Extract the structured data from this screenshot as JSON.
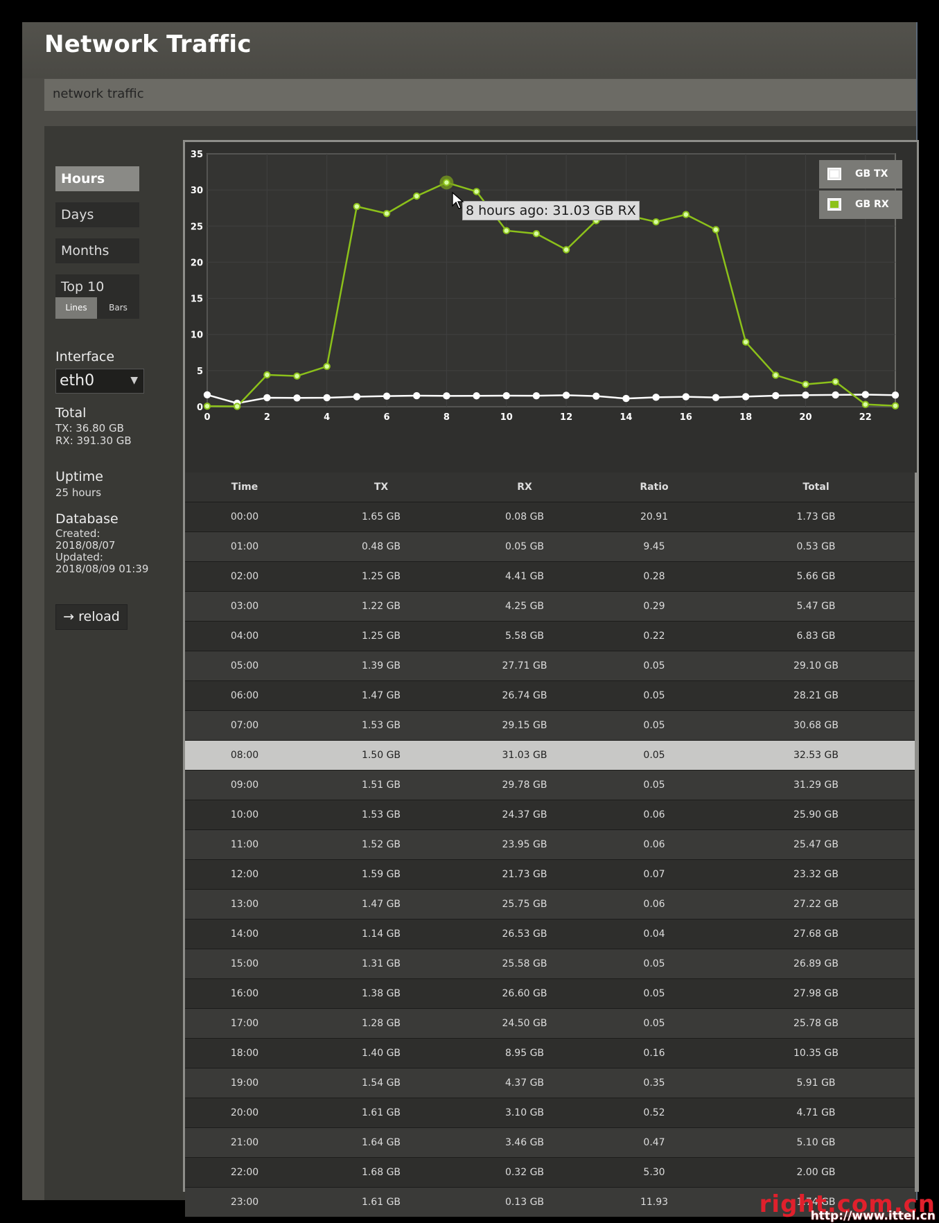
{
  "app": {
    "title": "Network Traffic",
    "subtitle": "network traffic"
  },
  "sidebar": {
    "nav": [
      {
        "label": "Hours",
        "active": true
      },
      {
        "label": "Days",
        "active": false
      },
      {
        "label": "Months",
        "active": false
      },
      {
        "label": "Top 10",
        "active": false
      }
    ],
    "view_toggle": {
      "lines": "Lines",
      "bars": "Bars",
      "selected": "Lines"
    },
    "interface_label": "Interface",
    "interface_value": "eth0",
    "total_label": "Total",
    "total_tx": "TX: 36.80 GB",
    "total_rx": "RX: 391.30 GB",
    "uptime_label": "Uptime",
    "uptime_value": "25 hours",
    "database_label": "Database",
    "created_label": "Created:",
    "created_value": "2018/08/07",
    "updated_label": "Updated:",
    "updated_value": "2018/08/09 01:39",
    "reload_label": "→ reload"
  },
  "legend": {
    "tx": "GB TX",
    "rx": "GB RX"
  },
  "tooltip": "8 hours ago: 31.03 GB RX",
  "colors": {
    "tx": "#ffffff",
    "rx": "#8cc11a",
    "grid": "#404040",
    "watermark": "#e0202c"
  },
  "chart_data": {
    "type": "line",
    "x": [
      0,
      1,
      2,
      3,
      4,
      5,
      6,
      7,
      8,
      9,
      10,
      11,
      12,
      13,
      14,
      15,
      16,
      17,
      18,
      19,
      20,
      21,
      22,
      23
    ],
    "x_ticks": [
      "0",
      "2",
      "4",
      "6",
      "8",
      "10",
      "12",
      "14",
      "16",
      "18",
      "20",
      "22"
    ],
    "y_ticks": [
      "0",
      "5",
      "10",
      "15",
      "20",
      "25",
      "30",
      "35"
    ],
    "ylim": [
      0,
      35
    ],
    "xlim": [
      0,
      23
    ],
    "grid": true,
    "legend_position": "top-right",
    "series": [
      {
        "name": "GB TX",
        "values": [
          1.65,
          0.48,
          1.25,
          1.22,
          1.25,
          1.39,
          1.47,
          1.53,
          1.5,
          1.51,
          1.53,
          1.52,
          1.59,
          1.47,
          1.14,
          1.31,
          1.38,
          1.28,
          1.4,
          1.54,
          1.61,
          1.64,
          1.68,
          1.61
        ]
      },
      {
        "name": "GB RX",
        "values": [
          0.08,
          0.05,
          4.41,
          4.25,
          5.58,
          27.71,
          26.74,
          29.15,
          31.03,
          29.78,
          24.37,
          23.95,
          21.73,
          25.75,
          26.53,
          25.58,
          26.6,
          24.5,
          8.95,
          4.37,
          3.1,
          3.46,
          0.32,
          0.13
        ]
      }
    ],
    "highlight_index": 8
  },
  "table": {
    "columns": [
      "Time",
      "TX",
      "RX",
      "Ratio",
      "Total"
    ],
    "rows": [
      [
        "00:00",
        "1.65 GB",
        "0.08 GB",
        "20.91",
        "1.73 GB"
      ],
      [
        "01:00",
        "0.48 GB",
        "0.05 GB",
        "9.45",
        "0.53 GB"
      ],
      [
        "02:00",
        "1.25 GB",
        "4.41 GB",
        "0.28",
        "5.66 GB"
      ],
      [
        "03:00",
        "1.22 GB",
        "4.25 GB",
        "0.29",
        "5.47 GB"
      ],
      [
        "04:00",
        "1.25 GB",
        "5.58 GB",
        "0.22",
        "6.83 GB"
      ],
      [
        "05:00",
        "1.39 GB",
        "27.71 GB",
        "0.05",
        "29.10 GB"
      ],
      [
        "06:00",
        "1.47 GB",
        "26.74 GB",
        "0.05",
        "28.21 GB"
      ],
      [
        "07:00",
        "1.53 GB",
        "29.15 GB",
        "0.05",
        "30.68 GB"
      ],
      [
        "08:00",
        "1.50 GB",
        "31.03 GB",
        "0.05",
        "32.53 GB"
      ],
      [
        "09:00",
        "1.51 GB",
        "29.78 GB",
        "0.05",
        "31.29 GB"
      ],
      [
        "10:00",
        "1.53 GB",
        "24.37 GB",
        "0.06",
        "25.90 GB"
      ],
      [
        "11:00",
        "1.52 GB",
        "23.95 GB",
        "0.06",
        "25.47 GB"
      ],
      [
        "12:00",
        "1.59 GB",
        "21.73 GB",
        "0.07",
        "23.32 GB"
      ],
      [
        "13:00",
        "1.47 GB",
        "25.75 GB",
        "0.06",
        "27.22 GB"
      ],
      [
        "14:00",
        "1.14 GB",
        "26.53 GB",
        "0.04",
        "27.68 GB"
      ],
      [
        "15:00",
        "1.31 GB",
        "25.58 GB",
        "0.05",
        "26.89 GB"
      ],
      [
        "16:00",
        "1.38 GB",
        "26.60 GB",
        "0.05",
        "27.98 GB"
      ],
      [
        "17:00",
        "1.28 GB",
        "24.50 GB",
        "0.05",
        "25.78 GB"
      ],
      [
        "18:00",
        "1.40 GB",
        "8.95 GB",
        "0.16",
        "10.35 GB"
      ],
      [
        "19:00",
        "1.54 GB",
        "4.37 GB",
        "0.35",
        "5.91 GB"
      ],
      [
        "20:00",
        "1.61 GB",
        "3.10 GB",
        "0.52",
        "4.71 GB"
      ],
      [
        "21:00",
        "1.64 GB",
        "3.46 GB",
        "0.47",
        "5.10 GB"
      ],
      [
        "22:00",
        "1.68 GB",
        "0.32 GB",
        "5.30",
        "2.00 GB"
      ],
      [
        "23:00",
        "1.61 GB",
        "0.13 GB",
        "11.93",
        "1.74 GB"
      ]
    ]
  },
  "watermark": {
    "main": "right.com.cn",
    "sub": "http://www.ittel.cn"
  }
}
